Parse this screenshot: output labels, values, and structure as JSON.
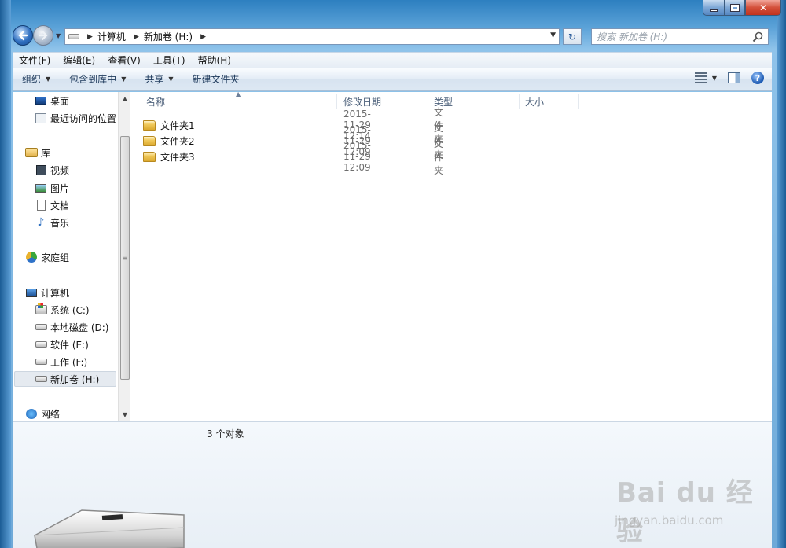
{
  "address": {
    "crumbs": [
      "计算机",
      "新加卷 (H:)"
    ]
  },
  "search": {
    "placeholder": "搜索 新加卷 (H:)"
  },
  "menubar": [
    "文件(F)",
    "编辑(E)",
    "查看(V)",
    "工具(T)",
    "帮助(H)"
  ],
  "toolbar": {
    "organize": "组织",
    "include_library": "包含到库中",
    "share": "共享",
    "new_folder": "新建文件夹"
  },
  "nav": {
    "favorites": [
      {
        "label": "桌面",
        "icon": "desktop-icon"
      },
      {
        "label": "最近访问的位置",
        "icon": "recent-places-icon"
      }
    ],
    "libraries": {
      "label": "库",
      "items": [
        {
          "label": "视频",
          "icon": "video-icon"
        },
        {
          "label": "图片",
          "icon": "picture-icon"
        },
        {
          "label": "文档",
          "icon": "document-icon"
        },
        {
          "label": "音乐",
          "icon": "music-icon"
        }
      ]
    },
    "homegroup": "家庭组",
    "computer": {
      "label": "计算机",
      "drives": [
        "系统 (C:)",
        "本地磁盘 (D:)",
        "软件 (E:)",
        "工作 (F:)",
        "新加卷 (H:)"
      ],
      "selected": "新加卷 (H:)"
    },
    "network": "网络"
  },
  "columns": [
    "名称",
    "修改日期",
    "类型",
    "大小"
  ],
  "files": [
    {
      "name": "文件夹1",
      "modified": "2015-11-29 12:14",
      "type": "文件夹"
    },
    {
      "name": "文件夹2",
      "modified": "2015-11-29 12:09",
      "type": "文件夹"
    },
    {
      "name": "文件夹3",
      "modified": "2015-11-29 12:09",
      "type": "文件夹"
    }
  ],
  "status": {
    "count": "3 个对象"
  },
  "watermark": {
    "logo": "Bai du 经验",
    "url": "jingyan.baidu.com"
  },
  "colors": {
    "frame": "#5ba2d8",
    "close_button": "#d4503b",
    "folder": "#f0c859"
  }
}
